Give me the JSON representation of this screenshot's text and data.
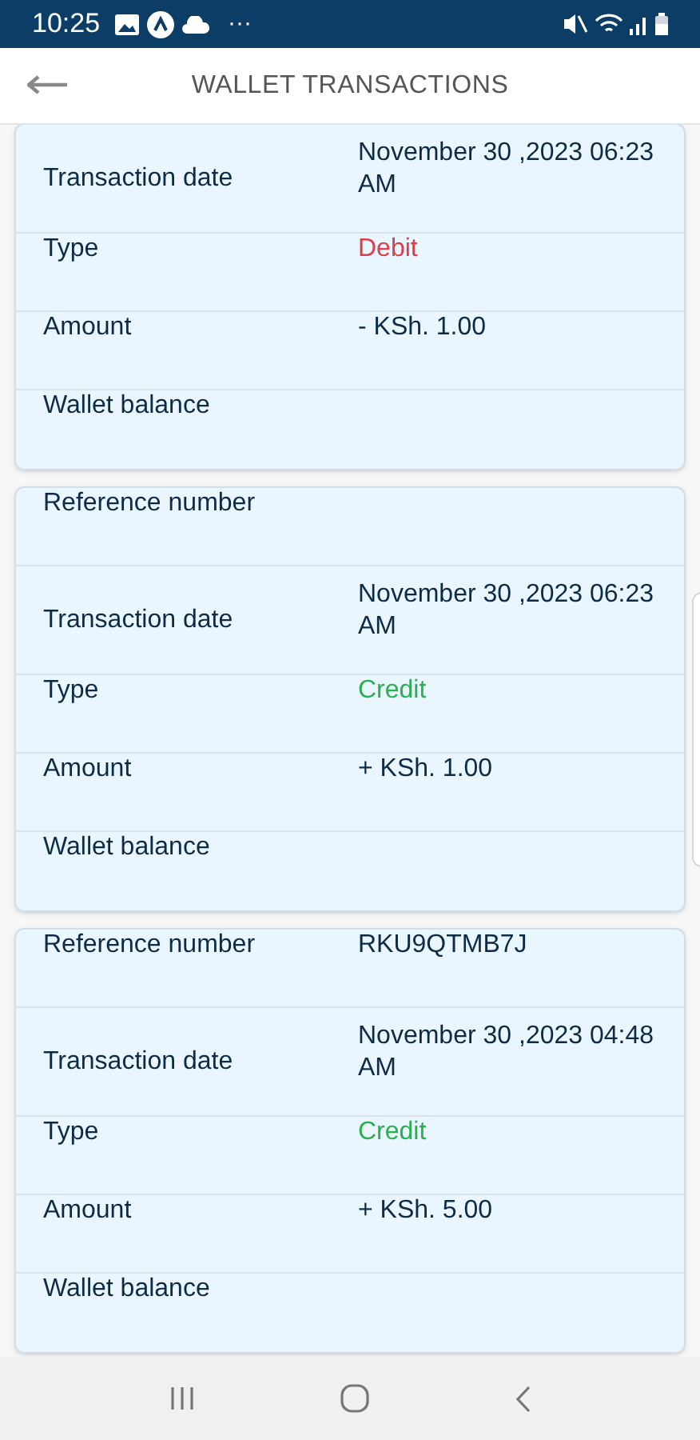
{
  "status_bar": {
    "time": "10:25",
    "more": "···"
  },
  "header": {
    "title": "WALLET TRANSACTIONS"
  },
  "cards": [
    {
      "rows": [
        {
          "label": "Transaction date",
          "value": "November 30 ,2023 06:23 AM",
          "kind": "plain"
        },
        {
          "label": "Type",
          "value": "Debit",
          "kind": "debit"
        },
        {
          "label": "Amount",
          "value": "- KSh. 1.00",
          "kind": "plain"
        },
        {
          "label": "Wallet balance"
        }
      ]
    },
    {
      "rows": [
        {
          "label": "Reference number"
        },
        {
          "label": "Transaction date",
          "value": "November 30 ,2023 06:23 AM",
          "kind": "plain"
        },
        {
          "label": "Type",
          "value": "Credit",
          "kind": "credit"
        },
        {
          "label": "Amount",
          "value": "+ KSh. 1.00",
          "kind": "plain"
        },
        {
          "label": "Wallet balance"
        }
      ]
    },
    {
      "rows": [
        {
          "label": "Reference number",
          "value": "RKU9QTMB7J",
          "kind": "plain"
        },
        {
          "label": "Transaction date",
          "value": "November 30 ,2023 04:48 AM",
          "kind": "plain"
        },
        {
          "label": "Type",
          "value": "Credit",
          "kind": "credit"
        },
        {
          "label": "Amount",
          "value": "+ KSh. 5.00",
          "kind": "plain"
        },
        {
          "label": "Wallet balance"
        }
      ]
    }
  ]
}
